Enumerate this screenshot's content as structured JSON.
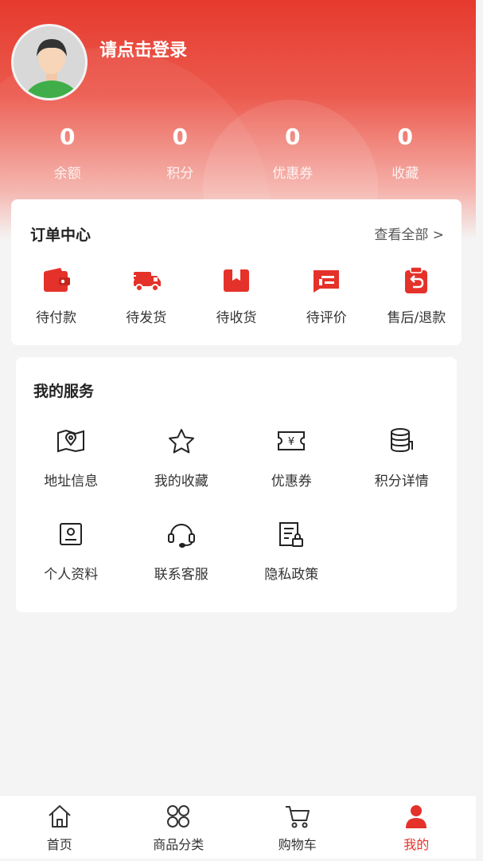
{
  "profile": {
    "login_prompt": "请点击登录"
  },
  "stats": [
    {
      "value": "0",
      "label": "余额"
    },
    {
      "value": "0",
      "label": "积分"
    },
    {
      "value": "0",
      "label": "优惠券"
    },
    {
      "value": "0",
      "label": "收藏"
    }
  ],
  "orders": {
    "title": "订单中心",
    "see_all": "查看全部 >",
    "items": [
      {
        "label": "待付款",
        "icon": "wallet-icon"
      },
      {
        "label": "待发货",
        "icon": "truck-icon"
      },
      {
        "label": "待收货",
        "icon": "package-icon"
      },
      {
        "label": "待评价",
        "icon": "comment-icon"
      },
      {
        "label": "售后/退款",
        "icon": "refund-icon"
      }
    ]
  },
  "services": {
    "title": "我的服务",
    "items": [
      {
        "label": "地址信息",
        "icon": "map-icon"
      },
      {
        "label": "我的收藏",
        "icon": "star-icon"
      },
      {
        "label": "优惠券",
        "icon": "coupon-icon"
      },
      {
        "label": "积分详情",
        "icon": "coins-icon"
      },
      {
        "label": "个人资料",
        "icon": "profile-card-icon"
      },
      {
        "label": "联系客服",
        "icon": "headset-icon"
      },
      {
        "label": "隐私政策",
        "icon": "privacy-doc-icon"
      }
    ]
  },
  "tabbar": {
    "items": [
      {
        "label": "首页",
        "icon": "home-icon"
      },
      {
        "label": "商品分类",
        "icon": "category-icon"
      },
      {
        "label": "购物车",
        "icon": "cart-icon"
      },
      {
        "label": "我的",
        "icon": "user-icon",
        "active": true
      }
    ]
  },
  "colors": {
    "accent": "#e4322a",
    "header_top": "#e63a2e"
  }
}
